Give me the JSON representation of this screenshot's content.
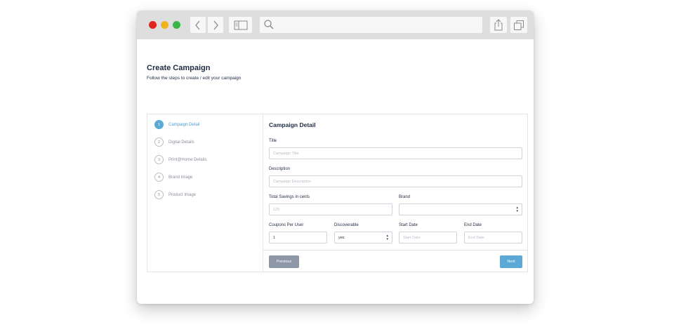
{
  "browser": {
    "icons": {
      "back": "chevron-left-icon",
      "forward": "chevron-right-icon",
      "sidebar": "sidebar-icon",
      "search": "search-icon",
      "share": "share-icon",
      "tabs": "tabs-icon"
    }
  },
  "page": {
    "title": "Create Campaign",
    "subtitle": "Follow the steps to create / edit your campaign"
  },
  "steps": [
    {
      "number": "1",
      "label": "Campaign Detail",
      "active": true
    },
    {
      "number": "2",
      "label": "Digital Details",
      "active": false
    },
    {
      "number": "3",
      "label": "Print@Home Details",
      "active": false
    },
    {
      "number": "4",
      "label": "Brand Image",
      "active": false
    },
    {
      "number": "5",
      "label": "Product Image",
      "active": false
    }
  ],
  "form": {
    "heading": "Campaign Detail",
    "title": {
      "label": "Title",
      "placeholder": "Campaign Title",
      "value": ""
    },
    "description": {
      "label": "Description",
      "placeholder": "Campaign Description",
      "value": ""
    },
    "total_savings": {
      "label": "Total Savings in cents",
      "placeholder": "125",
      "value": ""
    },
    "brand": {
      "label": "Brand",
      "value": ""
    },
    "coupons_per_user": {
      "label": "Coupons Per User",
      "value": "1"
    },
    "discoverable": {
      "label": "Discoverable",
      "value": "yes"
    },
    "start_date": {
      "label": "Start Date",
      "placeholder": "Start Date",
      "value": ""
    },
    "end_date": {
      "label": "End Date",
      "placeholder": "End Date",
      "value": ""
    }
  },
  "buttons": {
    "previous": "Previous",
    "next": "Next"
  },
  "colors": {
    "accent": "#5aa9d6",
    "secondary_button": "#8d97a6",
    "traffic_red": "#e0261b",
    "traffic_yellow": "#efb51f",
    "traffic_green": "#39b54a"
  }
}
